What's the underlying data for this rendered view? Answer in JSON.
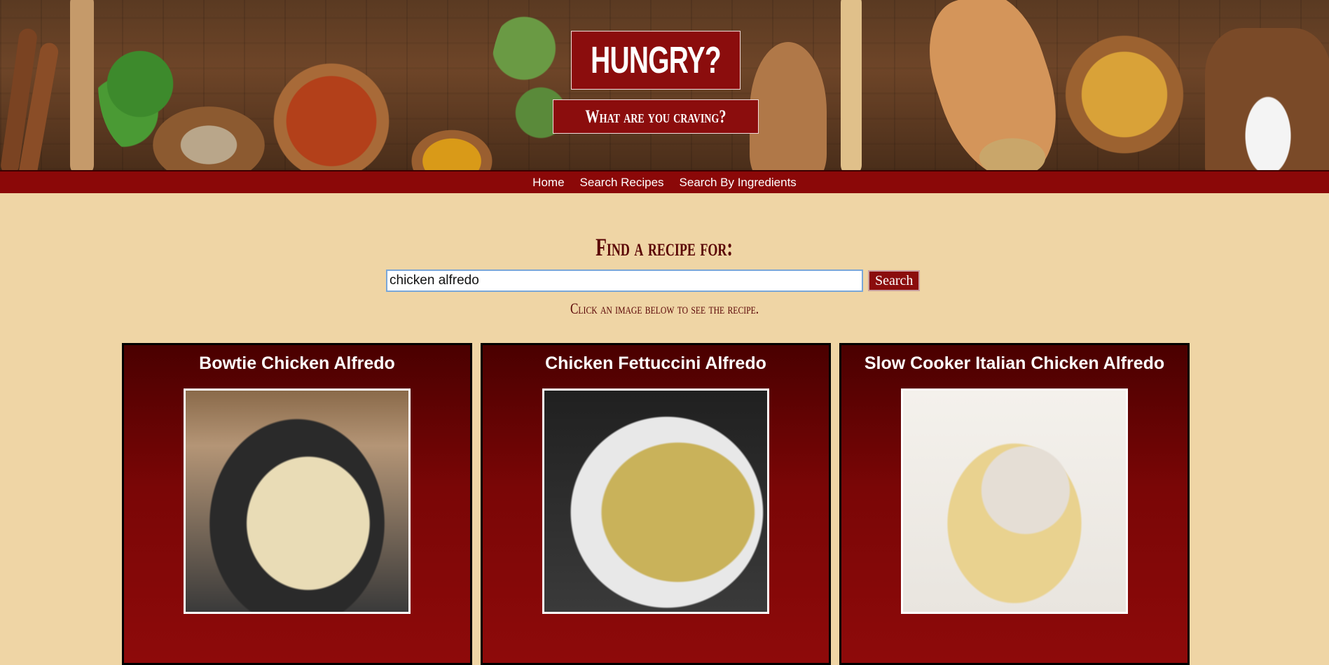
{
  "header": {
    "title": "HUNGRY?",
    "subtitle": "What are you craving?"
  },
  "nav": {
    "items": [
      {
        "label": "Home"
      },
      {
        "label": "Search Recipes"
      },
      {
        "label": "Search By Ingredients"
      }
    ]
  },
  "search": {
    "heading": "Find a recipe for:",
    "value": "chicken alfredo",
    "button_label": "Search",
    "hint": "Click an image below to see the recipe."
  },
  "results": [
    {
      "title": "Bowtie Chicken Alfredo"
    },
    {
      "title": "Chicken Fettuccini Alfredo"
    },
    {
      "title": "Slow Cooker Italian Chicken Alfredo"
    }
  ],
  "colors": {
    "page_background": "#efd5a5",
    "brand_red": "#8b0d0d",
    "heading_text": "#5a0505"
  }
}
